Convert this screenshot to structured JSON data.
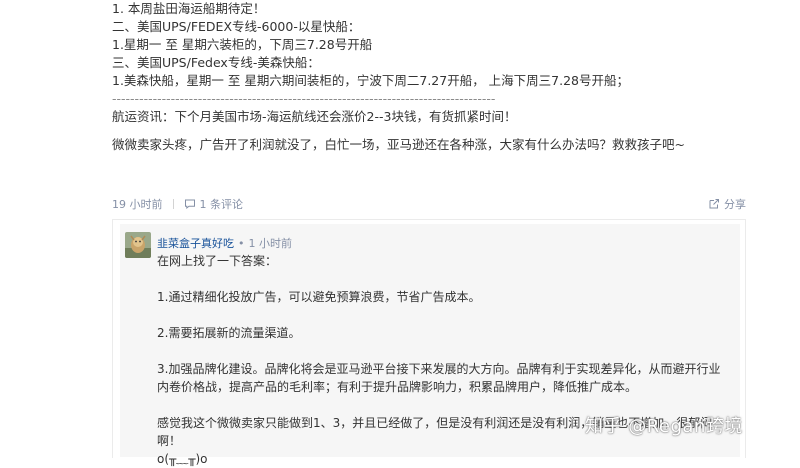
{
  "post": {
    "lines": [
      "1. 本周盐田海运船期待定！",
      "二、美国UPS/FEDEX专线-6000-以星快船：",
      "1.星期一 至  星期六装柜的，下周三7.28号开船",
      "三、美国UPS/Fedex专线-美森快船：",
      "1.美森快船，星期一 至 星期六期间装柜的，宁波下周二7.27开船，   上海下周三7.28号开船；"
    ],
    "separator": "-------------------------------------------------------------------------------------",
    "news": "航运资讯：下个月美国市场-海运航线还会涨价2--3块钱，有货抓紧时间！",
    "question": "微微卖家头疼，广告开了利润就没了，白忙一场，亚马逊还在各种涨，大家有什么办法吗？救救孩子吧~"
  },
  "meta": {
    "time": "19 小时前",
    "comment_label": "1 条评论",
    "share_label": "分享"
  },
  "reply": {
    "author": "韭菜盒子真好吃",
    "dot": "•",
    "time": "1 小时前",
    "paragraphs": [
      "在网上找了一下答案：",
      "1.通过精细化投放广告，可以避免预算浪费，节省广告成本。",
      "2.需要拓展新的流量渠道。",
      "3.加强品牌化建设。品牌化将会是亚马逊平台接下来发展的大方向。品牌有利于实现差异化，从而避开行业内卷价格战，提高产品的毛利率；有利于提升品牌影响力，积累品牌用户，降低推广成本。",
      "感觉我这个微微卖家只能做到1、3，并且已经做了，但是没有利润还是没有利润，销量也不增加，很郁闷啊！",
      "o(╥﹏╥)o"
    ]
  },
  "watermark": "知乎 @Regan跨境"
}
